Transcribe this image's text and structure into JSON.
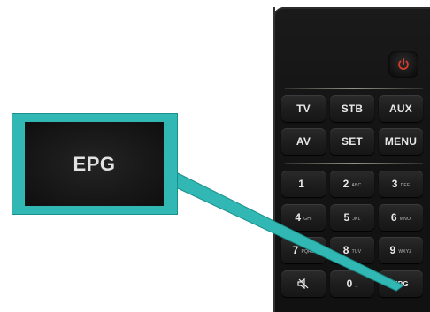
{
  "zoom": {
    "label": "EPG"
  },
  "remote": {
    "rows": [
      [
        {
          "label": "TV",
          "sub": ""
        },
        {
          "label": "STB",
          "sub": ""
        },
        {
          "label": "AUX",
          "sub": ""
        }
      ],
      [
        {
          "label": "AV",
          "sub": ""
        },
        {
          "label": "SET",
          "sub": ""
        },
        {
          "label": "MENU",
          "sub": ""
        }
      ],
      [
        {
          "label": "1",
          "sub": "."
        },
        {
          "label": "2",
          "sub": "ABC"
        },
        {
          "label": "3",
          "sub": "DEF"
        }
      ],
      [
        {
          "label": "4",
          "sub": "GHI"
        },
        {
          "label": "5",
          "sub": "JKL"
        },
        {
          "label": "6",
          "sub": "MNO"
        }
      ],
      [
        {
          "label": "7",
          "sub": "PQRS"
        },
        {
          "label": "8",
          "sub": "TUV"
        },
        {
          "label": "9",
          "sub": "WXYZ"
        }
      ],
      [
        {
          "label": "",
          "sub": ""
        },
        {
          "label": "0",
          "sub": "_"
        },
        {
          "label": "EPG",
          "sub": ""
        }
      ]
    ]
  },
  "colors": {
    "callout": "#31b8b4",
    "power": "#d83a2c"
  }
}
